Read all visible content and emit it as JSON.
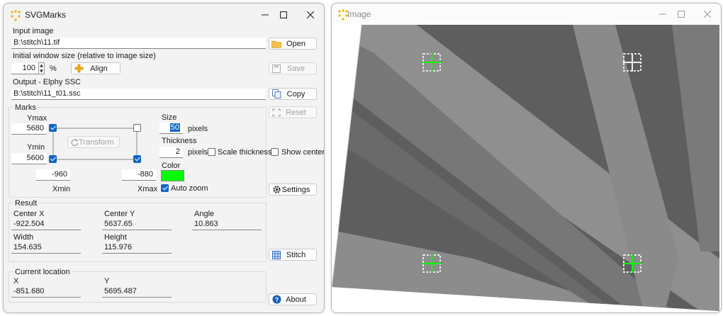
{
  "main_window": {
    "title": "SVGMarks",
    "input_image_label": "Input image",
    "input_image_value": "B:\\stitch\\11.tif",
    "window_size_label": "Initial window size (relative to image size)",
    "window_size_value": "100",
    "percent_label": "%",
    "align_label": "Align",
    "output_label": "Output - Elphy SSC",
    "output_value": "B:\\stitch\\11_t01.ssc",
    "buttons": {
      "open": "Open",
      "save": "Save",
      "copy": "Copy",
      "reset": "Reset",
      "show_center": "Show center",
      "settings": "Settings",
      "stitch": "Stitch",
      "about": "About"
    },
    "marks": {
      "group_label": "Marks",
      "ymax_label": "Ymax",
      "ymax_value": "5680",
      "ymin_label": "Ymin",
      "ymin_value": "5600",
      "transform_label": "Transform",
      "xmin_value": "-960",
      "xmax_value": "-880",
      "xmin_label": "Xmin",
      "xmax_label": "Xmax",
      "size_label": "Size",
      "size_value": "50",
      "size_unit": "pixels",
      "thickness_label": "Thickness",
      "thickness_value": "2",
      "thickness_unit": "pixels",
      "scale_thickness_label": "Scale thickness",
      "color_label": "Color",
      "color_value": "#00ff00",
      "auto_zoom_label": "Auto zoom"
    },
    "result": {
      "group_label": "Result",
      "center_x_label": "Center X",
      "center_x_value": "-922.504",
      "center_y_label": "Center Y",
      "center_y_value": "5637.65",
      "angle_label": "Angle",
      "angle_value": "10.863",
      "width_label": "Width",
      "width_value": "154.635",
      "height_label": "Height",
      "height_value": "115.976"
    },
    "location": {
      "group_label": "Current location",
      "x_label": "X",
      "x_value": "-851.680",
      "y_label": "Y",
      "y_value": "5695.487"
    }
  },
  "image_window": {
    "title": "Image",
    "mark_color": "#00ff00"
  }
}
